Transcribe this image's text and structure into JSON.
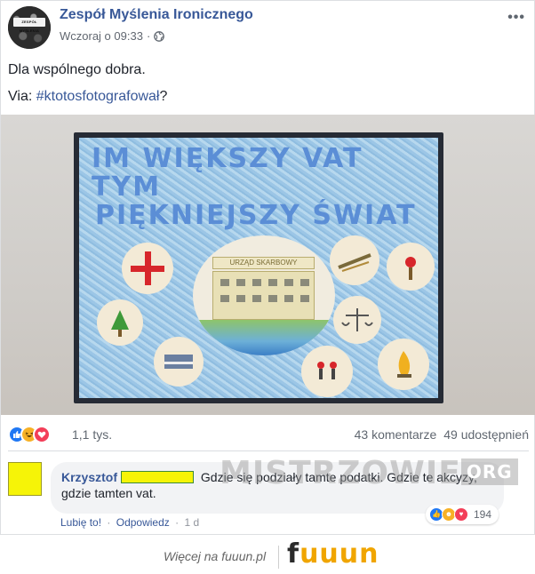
{
  "post": {
    "page_name": "Zespół Myślenia Ironicznego",
    "timestamp": "Wczoraj o 09:33",
    "separator": "·",
    "more_label": "•••",
    "avatar_banner": "ZESPÓŁ MYŚLENIA",
    "text_line1": "Dla wspólnego dobra.",
    "via_label": "Via: ",
    "hashtag": "#ktotosfotografował",
    "hashtag_suffix": "?"
  },
  "photo": {
    "board_title_line1": "IM WIĘKSZY VAT TYM",
    "board_title_line2": "PIĘKNIEJSZY ŚWIAT",
    "center_sign": "URZĄD SKARBOWY"
  },
  "reactions": {
    "icons": [
      "like-icon",
      "haha-icon",
      "love-icon"
    ],
    "count": "1,1 tys.",
    "comments": "43 komentarze",
    "shares": "49 udostępnień"
  },
  "comment": {
    "author": "Krzysztof",
    "text_part1": "Gdzie się podziały tamte podatki. Gdzie te",
    "text_part2": "akcyzy, gdzie tamten vat.",
    "reaction_count": "194",
    "like_label": "Lubię to!",
    "reply_label": "Odpowiedz",
    "time": "1 d",
    "action_separator": "·"
  },
  "watermark": {
    "text": "MISTRZOWIE",
    "suffix": "ORG"
  },
  "footer": {
    "more_text": "Więcej na fuuun.pl",
    "logo_f": "f",
    "logo_rest": "uuun"
  },
  "colors": {
    "link": "#385898",
    "like_blue": "#2078f4",
    "haha_yellow": "#f7b125",
    "love_red": "#f33e58",
    "redaction_yellow": "#f6f407"
  }
}
